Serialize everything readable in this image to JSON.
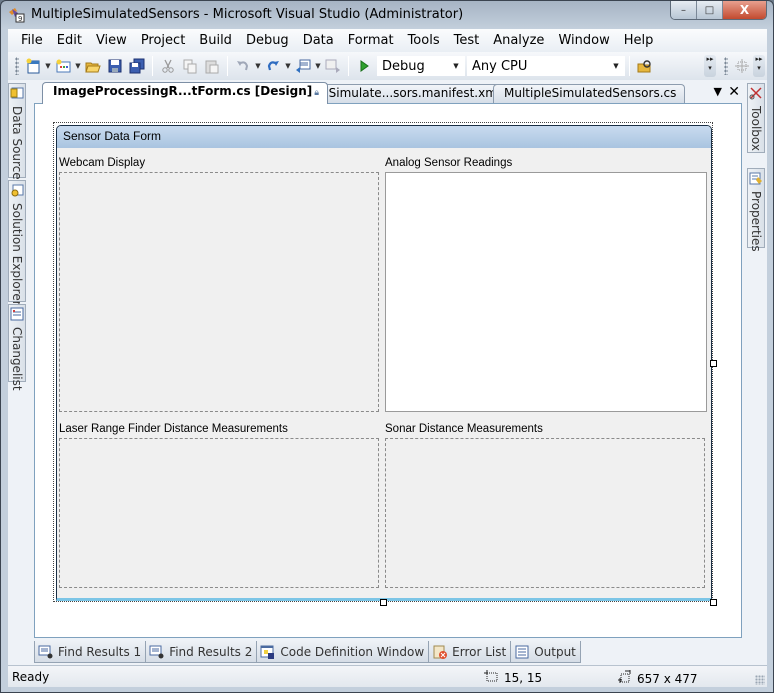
{
  "window": {
    "title": "MultipleSimulatedSensors - Microsoft Visual Studio (Administrator)",
    "controls": {
      "minimize": "–",
      "maximize": "□",
      "close": "X"
    }
  },
  "menubar": {
    "items": [
      {
        "label": "File"
      },
      {
        "label": "Edit"
      },
      {
        "label": "View"
      },
      {
        "label": "Project"
      },
      {
        "label": "Build"
      },
      {
        "label": "Debug"
      },
      {
        "label": "Data"
      },
      {
        "label": "Format"
      },
      {
        "label": "Tools"
      },
      {
        "label": "Test"
      },
      {
        "label": "Analyze"
      },
      {
        "label": "Window"
      },
      {
        "label": "Help"
      }
    ]
  },
  "toolbar": {
    "icons": [
      "new-project-icon",
      "add-item-icon",
      "open-file-icon",
      "save-icon",
      "save-all-icon",
      "cut-icon",
      "copy-icon",
      "paste-icon",
      "undo-icon",
      "redo-icon",
      "navigate-backward-icon",
      "navigate-forward-icon",
      "start-debugging-icon",
      "find-in-files-icon"
    ],
    "configuration": "Debug",
    "platform": "Any CPU"
  },
  "left_tool_windows": [
    {
      "label": "Data Sources",
      "icon": "data-sources-icon"
    },
    {
      "label": "Solution Explorer",
      "icon": "solution-explorer-icon"
    },
    {
      "label": "Changelist",
      "icon": "changelist-icon"
    }
  ],
  "right_tool_windows": [
    {
      "label": "Toolbox",
      "icon": "toolbox-icon"
    },
    {
      "label": "Properties",
      "icon": "properties-icon"
    }
  ],
  "document_tabs": [
    {
      "label": "ImageProcessingR...tForm.cs [Design]",
      "active": true,
      "locked": true
    },
    {
      "label": "MultipleSimulate...sors.manifest.xml",
      "active": false,
      "locked": true
    },
    {
      "label": "MultipleSimulatedSensors.cs",
      "active": false,
      "locked": false
    }
  ],
  "tab_controls": {
    "menu": "▼",
    "close": "✕"
  },
  "form": {
    "title": "Sensor Data Form",
    "labels": {
      "webcam": "Webcam Display",
      "analog": "Analog Sensor Readings",
      "laser": "Laser Range Finder Distance Measurements",
      "sonar": "Sonar Distance Measurements"
    }
  },
  "bottom_tabs": [
    {
      "label": "Find Results 1",
      "icon": "find-results-icon"
    },
    {
      "label": "Find Results 2",
      "icon": "find-results-icon"
    },
    {
      "label": "Code Definition Window",
      "icon": "code-definition-icon"
    },
    {
      "label": "Error List",
      "icon": "error-list-icon"
    },
    {
      "label": "Output",
      "icon": "output-icon"
    }
  ],
  "statusbar": {
    "status": "Ready",
    "position": "15, 15",
    "size": "657 x 477"
  }
}
